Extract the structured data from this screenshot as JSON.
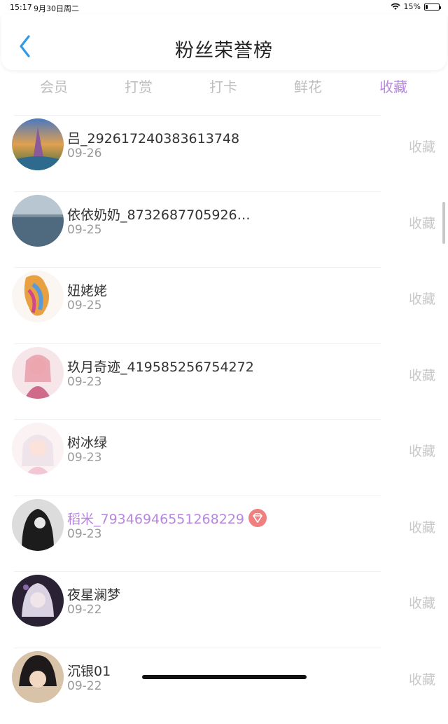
{
  "status": {
    "time": "15:17",
    "date": "9月30日周二",
    "battery": "15%",
    "battery_level": 0.15
  },
  "header": {
    "title": "粉丝荣誉榜",
    "back_icon": "chevron-left-icon",
    "accent": "#2f9be6"
  },
  "tabs": [
    {
      "label": "会员",
      "active": false
    },
    {
      "label": "打赏",
      "active": false
    },
    {
      "label": "打卡",
      "active": false
    },
    {
      "label": "鲜花",
      "active": false
    },
    {
      "label": "收藏",
      "active": true
    }
  ],
  "accent_color": "#b787e0",
  "fans": [
    {
      "name": "吕_292617240383613748",
      "date": "09-26",
      "type": "收藏",
      "vip": false
    },
    {
      "name": "依依奶奶_8732687705926…",
      "date": "09-25",
      "type": "收藏",
      "vip": false
    },
    {
      "name": "妞姥姥",
      "date": "09-25",
      "type": "收藏",
      "vip": false
    },
    {
      "name": "玖月奇迹_419585256754272",
      "date": "09-23",
      "type": "收藏",
      "vip": false
    },
    {
      "name": "树冰绿",
      "date": "09-23",
      "type": "收藏",
      "vip": false
    },
    {
      "name": "稻米_79346946551268229",
      "date": "09-23",
      "type": "收藏",
      "vip": true
    },
    {
      "name": "夜星澜梦",
      "date": "09-22",
      "type": "收藏",
      "vip": false
    },
    {
      "name": "沉银01",
      "date": "09-22",
      "type": "收藏",
      "vip": false
    }
  ]
}
